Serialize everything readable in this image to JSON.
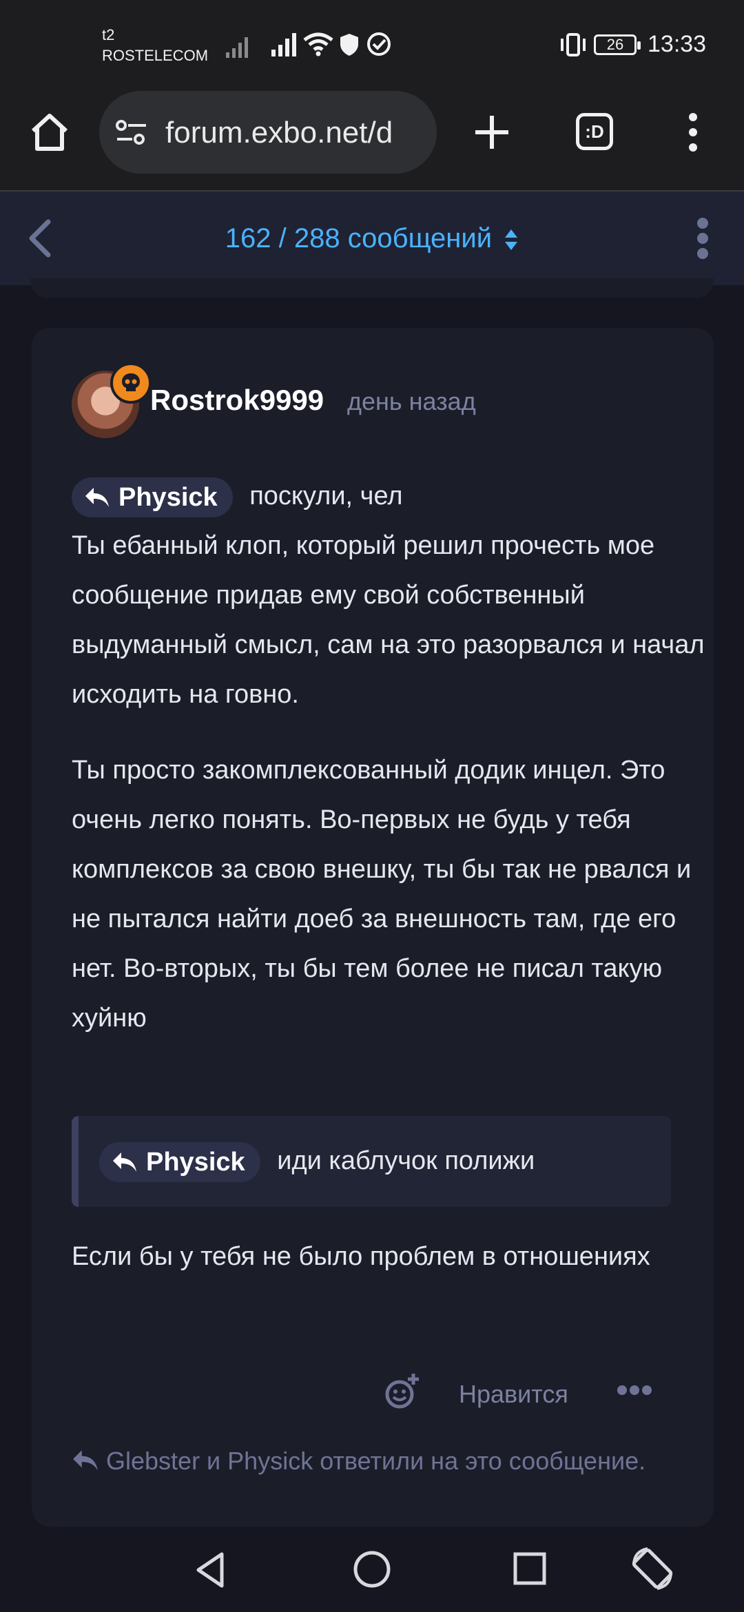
{
  "status_bar": {
    "carrier_line1": "t2",
    "carrier_line2": "ROSTELECOM",
    "battery": "26",
    "time": "13:33"
  },
  "browser": {
    "url": "forum.exbo.net/d",
    "tabs_label": ":D"
  },
  "forum_header": {
    "scrubber": "162 / 288 сообщений"
  },
  "post": {
    "username": "Rostrok9999",
    "time": "день назад",
    "mention1": "Physick",
    "line1_after_mention": "поскули, чел",
    "paragraph1": "Ты ебанный клоп, который решил прочесть мое сообщение придав ему свой собственный выдуманный смысл, сам на это разорвался и начал исходить на говно.",
    "paragraph2": "Ты просто закомплексованный додик инцел. Это очень легко понять. Во-первых не будь у тебя комплексов за свою внешку, ты бы так не рвался и не пытался найти доеб за внешность там, где его нет. Во-вторых, ты бы тем более не писал такую хуйню",
    "quote_mention": "Physick",
    "quote_text": "иди каблучок полижи",
    "paragraph3": "Если бы у тебя не было проблем в отношениях",
    "like_label": "Нравится",
    "replies_text": "Glebster и Physick ответили на это сообщение."
  },
  "colors": {
    "accent": "#4ab3ff",
    "badge": "#f08a1c",
    "background": "#15161f",
    "card": "#1b1d29"
  }
}
